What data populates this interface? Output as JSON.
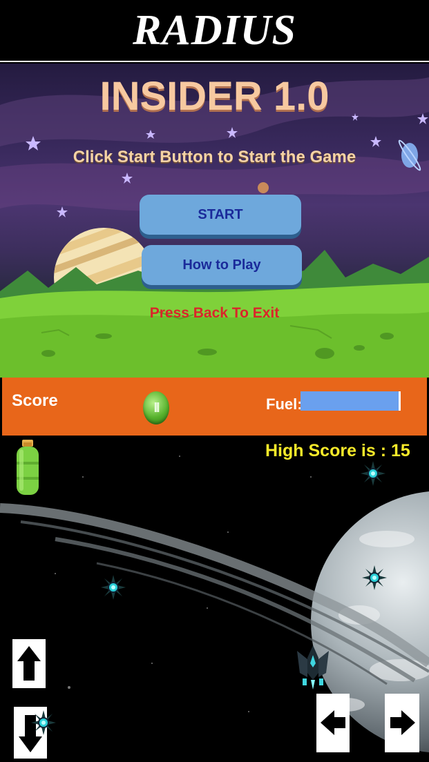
{
  "header": {
    "title": "RADIUS"
  },
  "menu": {
    "title": "INSIDER 1.0",
    "subtitle": "Click Start Button to Start the Game",
    "start_label": "START",
    "howto_label": "How to Play",
    "exit_text": "Press Back To Exit"
  },
  "hud": {
    "score_label": "Score",
    "fuel_label": "Fuel:",
    "fuel_level_fraction": 1.0,
    "pause_icon": "pause-icon"
  },
  "game": {
    "high_score_text": "High Score is : 15"
  },
  "icons": {
    "up": "arrow-up-icon",
    "down": "arrow-down-icon",
    "left": "arrow-left-icon",
    "right": "arrow-right-icon",
    "fuel_tank": "fuel-tank-icon",
    "enemy_mine": "space-mine-icon",
    "player_ship": "spaceship-icon"
  },
  "colors": {
    "hud_bg": "#e8661a",
    "fuel_bar": "#6aa0ee",
    "button_bg": "#6ea8dc",
    "button_text": "#1a2a9a",
    "exit_text": "#d8262a",
    "high_score": "#f7ea2a",
    "menu_title": "#f7c9a0"
  }
}
